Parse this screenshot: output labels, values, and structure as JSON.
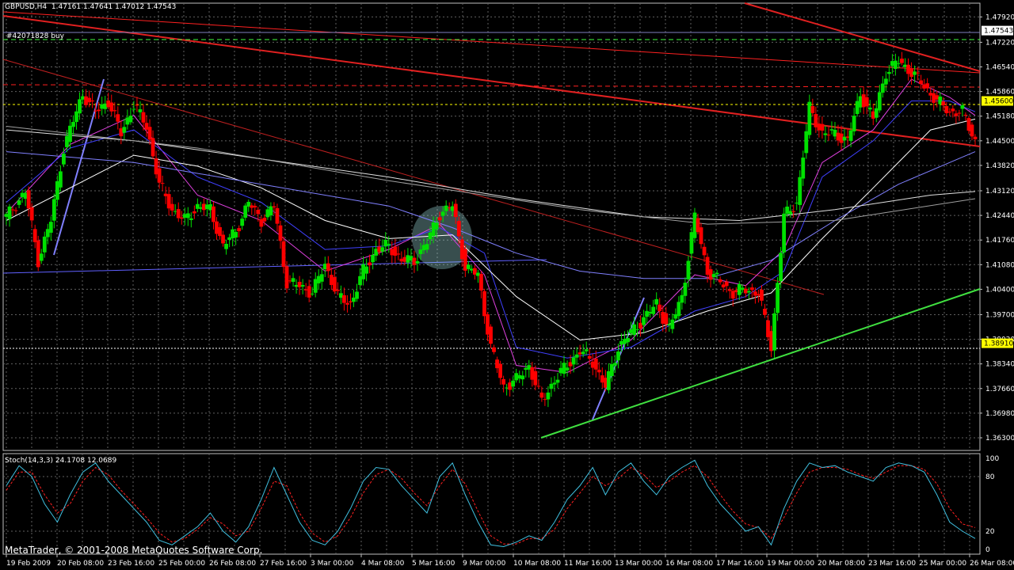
{
  "chart_data": {
    "type": "candlestick",
    "title": "GBPUSD,H4",
    "ohlc_readout": "1.47161 1.47641 1.47012 1.47543",
    "order_label": "#42071828 buy",
    "ylim": [
      1.3595,
      1.483
    ],
    "y_ticks": [
      "1.47920",
      "1.47220",
      "1.46540",
      "1.45860",
      "1.45180",
      "1.44500",
      "1.43820",
      "1.43120",
      "1.42440",
      "1.41760",
      "1.41080",
      "1.40400",
      "1.39700",
      "1.39020",
      "1.38340",
      "1.37660",
      "1.36980",
      "1.36300"
    ],
    "price_tags": [
      {
        "value": "1.47543",
        "fill": "#ffffff",
        "text": "#000000"
      },
      {
        "value": "1.45600",
        "fill": "#ffff00",
        "text": "#000000"
      },
      {
        "value": "1.38910",
        "fill": "#ffff00",
        "text": "#000000"
      }
    ],
    "x_ticks": [
      "19 Feb 2009",
      "20 Feb 08:00",
      "23 Feb 16:00",
      "25 Feb 00:00",
      "26 Feb 08:00",
      "27 Feb 16:00",
      "3 Mar 00:00",
      "4 Mar 08:00",
      "5 Mar 16:00",
      "9 Mar 00:00",
      "10 Mar 08:00",
      "11 Mar 16:00",
      "13 Mar 00:00",
      "16 Mar 08:00",
      "17 Mar 16:00",
      "19 Mar 00:00",
      "20 Mar 08:00",
      "23 Mar 16:00",
      "25 Mar 00:00",
      "26 Mar 08:00"
    ],
    "close_anchors": [
      [
        0,
        1.424
      ],
      [
        6,
        1.431
      ],
      [
        10,
        1.412
      ],
      [
        14,
        1.423
      ],
      [
        18,
        1.443
      ],
      [
        20,
        1.448
      ],
      [
        24,
        1.458
      ],
      [
        28,
        1.453
      ],
      [
        32,
        1.456
      ],
      [
        36,
        1.447
      ],
      [
        40,
        1.455
      ],
      [
        44,
        1.449
      ],
      [
        48,
        1.433
      ],
      [
        52,
        1.426
      ],
      [
        56,
        1.423
      ],
      [
        60,
        1.427
      ],
      [
        64,
        1.426
      ],
      [
        68,
        1.416
      ],
      [
        72,
        1.42
      ],
      [
        76,
        1.428
      ],
      [
        80,
        1.423
      ],
      [
        84,
        1.427
      ],
      [
        88,
        1.406
      ],
      [
        92,
        1.405
      ],
      [
        96,
        1.403
      ],
      [
        100,
        1.411
      ],
      [
        104,
        1.402
      ],
      [
        108,
        1.4
      ],
      [
        112,
        1.409
      ],
      [
        116,
        1.415
      ],
      [
        120,
        1.416
      ],
      [
        124,
        1.412
      ],
      [
        128,
        1.412
      ],
      [
        132,
        1.417
      ],
      [
        136,
        1.425
      ],
      [
        140,
        1.427
      ],
      [
        144,
        1.41
      ],
      [
        148,
        1.408
      ],
      [
        152,
        1.388
      ],
      [
        156,
        1.377
      ],
      [
        160,
        1.379
      ],
      [
        164,
        1.383
      ],
      [
        168,
        1.373
      ],
      [
        172,
        1.379
      ],
      [
        176,
        1.383
      ],
      [
        180,
        1.387
      ],
      [
        184,
        1.384
      ],
      [
        188,
        1.377
      ],
      [
        192,
        1.388
      ],
      [
        196,
        1.392
      ],
      [
        200,
        1.396
      ],
      [
        204,
        1.4
      ],
      [
        208,
        1.393
      ],
      [
        212,
        1.402
      ],
      [
        216,
        1.424
      ],
      [
        220,
        1.409
      ],
      [
        224,
        1.406
      ],
      [
        228,
        1.403
      ],
      [
        232,
        1.404
      ],
      [
        236,
        1.403
      ],
      [
        240,
        1.388
      ],
      [
        244,
        1.424
      ],
      [
        248,
        1.428
      ],
      [
        252,
        1.454
      ],
      [
        256,
        1.447
      ],
      [
        260,
        1.447
      ],
      [
        264,
        1.445
      ],
      [
        268,
        1.458
      ],
      [
        272,
        1.451
      ],
      [
        276,
        1.464
      ],
      [
        280,
        1.467
      ],
      [
        284,
        1.464
      ],
      [
        288,
        1.46
      ],
      [
        292,
        1.456
      ],
      [
        296,
        1.453
      ],
      [
        300,
        1.453
      ],
      [
        304,
        1.445
      ]
    ],
    "moving_averages": [
      {
        "color": "#e040e0",
        "points": [
          [
            0,
            1.425
          ],
          [
            20,
            1.444
          ],
          [
            40,
            1.452
          ],
          [
            60,
            1.43
          ],
          [
            80,
            1.423
          ],
          [
            100,
            1.409
          ],
          [
            120,
            1.415
          ],
          [
            136,
            1.422
          ],
          [
            150,
            1.408
          ],
          [
            160,
            1.383
          ],
          [
            176,
            1.381
          ],
          [
            196,
            1.39
          ],
          [
            216,
            1.408
          ],
          [
            232,
            1.405
          ],
          [
            244,
            1.415
          ],
          [
            256,
            1.439
          ],
          [
            272,
            1.448
          ],
          [
            284,
            1.462
          ],
          [
            296,
            1.457
          ],
          [
            304,
            1.452
          ]
        ]
      },
      {
        "color": "#4040ff",
        "points": [
          [
            0,
            1.428
          ],
          [
            20,
            1.443
          ],
          [
            40,
            1.448
          ],
          [
            60,
            1.435
          ],
          [
            80,
            1.428
          ],
          [
            100,
            1.415
          ],
          [
            120,
            1.416
          ],
          [
            136,
            1.421
          ],
          [
            150,
            1.414
          ],
          [
            160,
            1.388
          ],
          [
            176,
            1.385
          ],
          [
            196,
            1.388
          ],
          [
            216,
            1.398
          ],
          [
            232,
            1.402
          ],
          [
            244,
            1.409
          ],
          [
            256,
            1.435
          ],
          [
            272,
            1.445
          ],
          [
            284,
            1.456
          ],
          [
            296,
            1.456
          ],
          [
            304,
            1.453
          ]
        ]
      },
      {
        "color": "#ffffff",
        "points": [
          [
            0,
            1.423
          ],
          [
            20,
            1.432
          ],
          [
            40,
            1.441
          ],
          [
            60,
            1.438
          ],
          [
            80,
            1.432
          ],
          [
            100,
            1.423
          ],
          [
            120,
            1.418
          ],
          [
            140,
            1.419
          ],
          [
            160,
            1.402
          ],
          [
            180,
            1.39
          ],
          [
            200,
            1.392
          ],
          [
            220,
            1.398
          ],
          [
            240,
            1.403
          ],
          [
            256,
            1.418
          ],
          [
            272,
            1.432
          ],
          [
            290,
            1.448
          ],
          [
            304,
            1.451
          ]
        ]
      },
      {
        "color": "#8080ff",
        "points": [
          [
            0,
            1.442
          ],
          [
            40,
            1.439
          ],
          [
            80,
            1.433
          ],
          [
            120,
            1.427
          ],
          [
            140,
            1.421
          ],
          [
            160,
            1.414
          ],
          [
            180,
            1.409
          ],
          [
            200,
            1.407
          ],
          [
            220,
            1.407
          ],
          [
            240,
            1.412
          ],
          [
            260,
            1.423
          ],
          [
            280,
            1.433
          ],
          [
            304,
            1.442
          ]
        ]
      },
      {
        "color": "#e0e0e0",
        "points": [
          [
            0,
            1.448
          ],
          [
            40,
            1.445
          ],
          [
            80,
            1.44
          ],
          [
            120,
            1.435
          ],
          [
            160,
            1.429
          ],
          [
            200,
            1.424
          ],
          [
            230,
            1.423
          ],
          [
            260,
            1.426
          ],
          [
            290,
            1.43
          ],
          [
            304,
            1.431
          ]
        ]
      },
      {
        "color": "#a0a0a0",
        "points": [
          [
            0,
            1.449
          ],
          [
            60,
            1.443
          ],
          [
            120,
            1.434
          ],
          [
            180,
            1.426
          ],
          [
            220,
            1.422
          ],
          [
            260,
            1.423
          ],
          [
            304,
            1.429
          ]
        ]
      }
    ],
    "stochastic": {
      "label": "Stoch(14,3,3) 24.1708 12.0689",
      "levels": [
        "100",
        "80",
        "20",
        "0"
      ],
      "main_color": "#40c0e0",
      "signal_color": "#ff2020",
      "k": [
        [
          0,
          70
        ],
        [
          4,
          92
        ],
        [
          8,
          80
        ],
        [
          12,
          50
        ],
        [
          16,
          30
        ],
        [
          20,
          60
        ],
        [
          24,
          85
        ],
        [
          28,
          95
        ],
        [
          32,
          75
        ],
        [
          36,
          60
        ],
        [
          40,
          45
        ],
        [
          44,
          30
        ],
        [
          48,
          10
        ],
        [
          52,
          5
        ],
        [
          56,
          15
        ],
        [
          60,
          25
        ],
        [
          64,
          40
        ],
        [
          68,
          20
        ],
        [
          72,
          8
        ],
        [
          76,
          25
        ],
        [
          80,
          55
        ],
        [
          84,
          90
        ],
        [
          88,
          60
        ],
        [
          92,
          30
        ],
        [
          96,
          10
        ],
        [
          100,
          5
        ],
        [
          104,
          20
        ],
        [
          108,
          45
        ],
        [
          112,
          75
        ],
        [
          116,
          90
        ],
        [
          120,
          88
        ],
        [
          124,
          70
        ],
        [
          128,
          55
        ],
        [
          132,
          40
        ],
        [
          136,
          80
        ],
        [
          140,
          95
        ],
        [
          144,
          60
        ],
        [
          148,
          30
        ],
        [
          152,
          5
        ],
        [
          156,
          3
        ],
        [
          160,
          8
        ],
        [
          164,
          15
        ],
        [
          168,
          10
        ],
        [
          172,
          30
        ],
        [
          176,
          55
        ],
        [
          180,
          70
        ],
        [
          184,
          90
        ],
        [
          188,
          60
        ],
        [
          192,
          85
        ],
        [
          196,
          95
        ],
        [
          200,
          75
        ],
        [
          204,
          60
        ],
        [
          208,
          80
        ],
        [
          212,
          90
        ],
        [
          216,
          98
        ],
        [
          220,
          70
        ],
        [
          224,
          50
        ],
        [
          228,
          35
        ],
        [
          232,
          20
        ],
        [
          236,
          25
        ],
        [
          240,
          5
        ],
        [
          244,
          45
        ],
        [
          248,
          75
        ],
        [
          252,
          95
        ],
        [
          256,
          90
        ],
        [
          260,
          92
        ],
        [
          264,
          85
        ],
        [
          268,
          80
        ],
        [
          272,
          75
        ],
        [
          276,
          90
        ],
        [
          280,
          95
        ],
        [
          284,
          92
        ],
        [
          288,
          85
        ],
        [
          292,
          60
        ],
        [
          296,
          30
        ],
        [
          300,
          20
        ],
        [
          304,
          12
        ]
      ],
      "d": [
        [
          0,
          65
        ],
        [
          4,
          85
        ],
        [
          8,
          85
        ],
        [
          12,
          60
        ],
        [
          16,
          40
        ],
        [
          20,
          50
        ],
        [
          24,
          75
        ],
        [
          28,
          90
        ],
        [
          32,
          82
        ],
        [
          36,
          65
        ],
        [
          40,
          50
        ],
        [
          44,
          35
        ],
        [
          48,
          18
        ],
        [
          52,
          8
        ],
        [
          56,
          12
        ],
        [
          60,
          22
        ],
        [
          64,
          35
        ],
        [
          68,
          28
        ],
        [
          72,
          15
        ],
        [
          76,
          20
        ],
        [
          80,
          45
        ],
        [
          84,
          75
        ],
        [
          88,
          70
        ],
        [
          92,
          40
        ],
        [
          96,
          18
        ],
        [
          100,
          8
        ],
        [
          104,
          15
        ],
        [
          108,
          35
        ],
        [
          112,
          62
        ],
        [
          116,
          82
        ],
        [
          120,
          88
        ],
        [
          124,
          78
        ],
        [
          128,
          62
        ],
        [
          132,
          48
        ],
        [
          136,
          70
        ],
        [
          140,
          88
        ],
        [
          144,
          72
        ],
        [
          148,
          42
        ],
        [
          152,
          15
        ],
        [
          156,
          6
        ],
        [
          160,
          6
        ],
        [
          164,
          12
        ],
        [
          168,
          12
        ],
        [
          172,
          22
        ],
        [
          176,
          45
        ],
        [
          180,
          62
        ],
        [
          184,
          80
        ],
        [
          188,
          70
        ],
        [
          192,
          78
        ],
        [
          196,
          90
        ],
        [
          200,
          82
        ],
        [
          204,
          68
        ],
        [
          208,
          75
        ],
        [
          212,
          85
        ],
        [
          216,
          92
        ],
        [
          220,
          80
        ],
        [
          224,
          60
        ],
        [
          228,
          42
        ],
        [
          232,
          28
        ],
        [
          236,
          24
        ],
        [
          240,
          12
        ],
        [
          244,
          35
        ],
        [
          248,
          62
        ],
        [
          252,
          85
        ],
        [
          256,
          90
        ],
        [
          260,
          90
        ],
        [
          264,
          88
        ],
        [
          268,
          82
        ],
        [
          272,
          78
        ],
        [
          276,
          85
        ],
        [
          280,
          92
        ],
        [
          284,
          92
        ],
        [
          288,
          88
        ],
        [
          292,
          72
        ],
        [
          296,
          45
        ],
        [
          300,
          28
        ],
        [
          304,
          24
        ]
      ]
    },
    "footer": "MetaTrader, © 2001-2008 MetaQuotes Software Corp."
  }
}
